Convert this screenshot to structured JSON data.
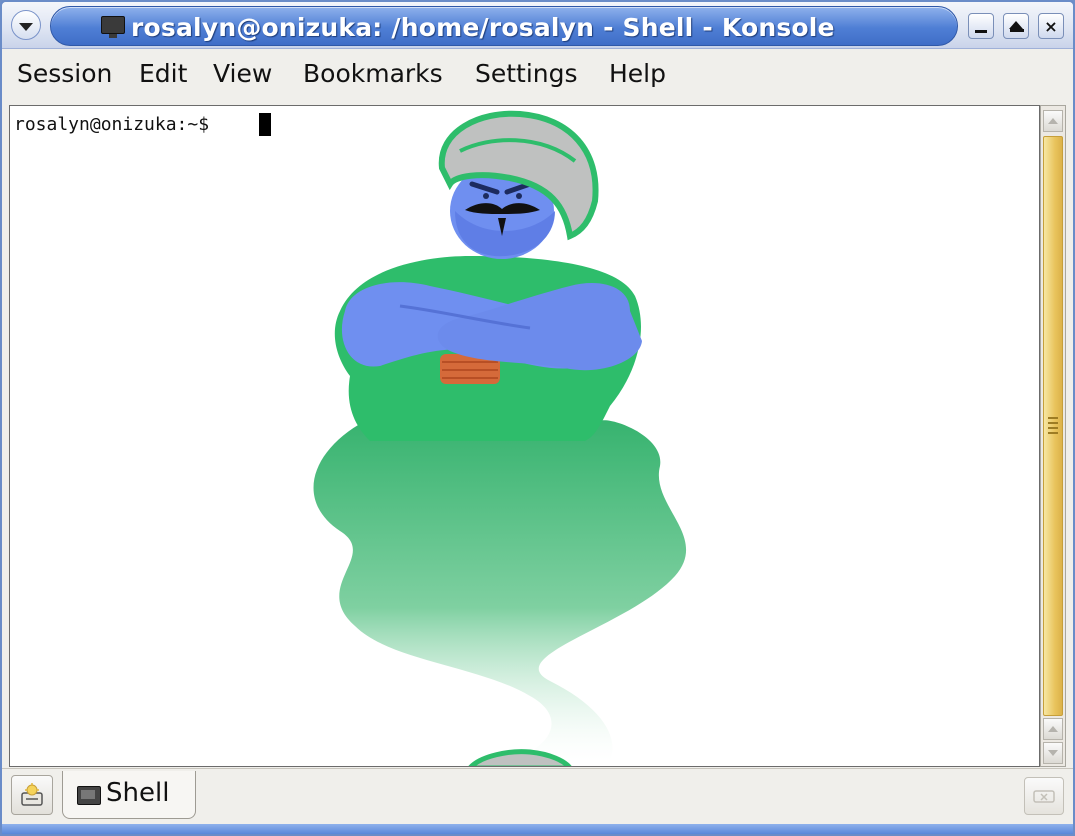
{
  "window": {
    "title": "rosalyn@onizuka: /home/rosalyn - Shell - Konsole",
    "controls": {
      "minimize_icon": "minimize-icon",
      "maximize_icon": "maximize-icon",
      "close_label": "×"
    }
  },
  "menubar": {
    "items": [
      "Session",
      "Edit",
      "View",
      "Bookmarks",
      "Settings",
      "Help"
    ]
  },
  "terminal": {
    "prompt": "rosalyn@onizuka:~$ ",
    "background_image": "genie-illustration",
    "background_color": "#ffffff"
  },
  "scrollbar": {
    "thumb_color": "#e9c45d",
    "position_fraction": 1.0
  },
  "tabbar": {
    "tabs": [
      {
        "label": "Shell",
        "icon": "terminal-icon",
        "active": true
      }
    ],
    "new_tab_icon": "new-session-icon",
    "close_tab_icon": "close-tab-icon"
  },
  "colors": {
    "titlebar_accent": "#4f7fd5",
    "frame": "#6a8cc8"
  }
}
